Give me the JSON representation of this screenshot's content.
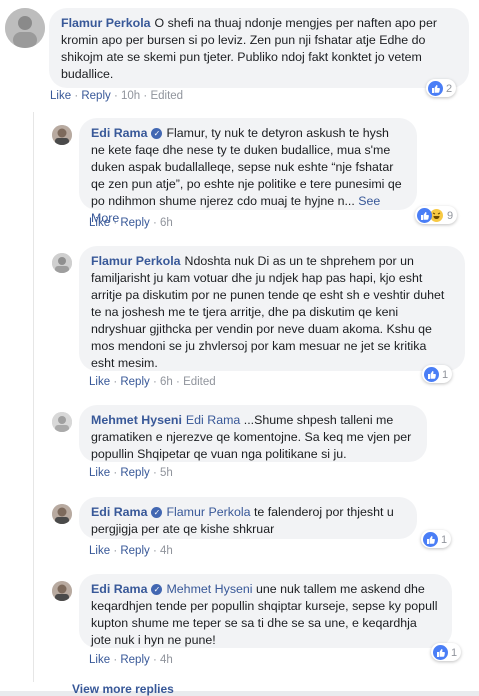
{
  "comments": [
    {
      "name": "Flamur Perkola",
      "verified": false,
      "mention": "",
      "text": "O shefi na thuaj ndonje mengjes per naften apo per kromin apo per bursen si po leviz. Zen pun nji fshatar atje Edhe do shikojm ate se skemi pun tjeter. Publiko ndoj fakt konktet jo vetem budallice.",
      "see_more": "",
      "like": "Like",
      "reply": "Reply",
      "time": "10h",
      "edited": "Edited",
      "reaction_count": "2"
    },
    {
      "name": "Edi Rama",
      "verified": true,
      "mention": "",
      "text": "Flamur, ty nuk te detyron askush te hysh ne kete faqe dhe nese ty te duken budallice, mua s'me duken aspak budallalleqe, sepse nuk eshte “nje fshatar qe zen pun atje”, po eshte nje politike e tere punesimi qe po ndihmon shume njerez cdo muaj te hyjne n...",
      "see_more": "See More",
      "like": "Like",
      "reply": "Reply",
      "time": "6h",
      "edited": "",
      "reaction_count": "9"
    },
    {
      "name": "Flamur Perkola",
      "verified": false,
      "mention": "",
      "text": "Ndoshta nuk Di as un te shprehem por un familjarisht ju kam votuar dhe ju ndjek hap pas hapi, kjo esht arritje pa diskutim por ne punen tende qe esht sh e veshtir duhet te na joshesh me te tjera arritje, dhe pa diskutim qe keni ndryshuar gjithcka per vendin por neve duam akoma. Kshu qe mos mendoni se ju zhvlersoj por kam mesuar ne jet se kritika esht mesim.",
      "see_more": "",
      "like": "Like",
      "reply": "Reply",
      "time": "6h",
      "edited": "Edited",
      "reaction_count": "1"
    },
    {
      "name": "Mehmet Hyseni",
      "verified": false,
      "mention": "Edi Rama",
      "text": "...Shume shpesh talleni me gramatiken e njerezve qe komentojne. Sa keq me vjen per popullin Shqipetar qe vuan nga politikane si ju.",
      "see_more": "",
      "like": "Like",
      "reply": "Reply",
      "time": "5h",
      "edited": "",
      "reaction_count": ""
    },
    {
      "name": "Edi Rama",
      "verified": true,
      "mention": "Flamur Perkola",
      "text": "te falenderoj por thjesht u pergjigja per ate qe kishe shkruar",
      "see_more": "",
      "like": "Like",
      "reply": "Reply",
      "time": "4h",
      "edited": "",
      "reaction_count": "1"
    },
    {
      "name": "Edi Rama",
      "verified": true,
      "mention": "Mehmet Hyseni",
      "text": "une nuk tallem me askend dhe keqardhjen tende per popullin shqiptar kurseje, sepse ky popull kupton shume me teper se sa ti dhe se sa une, e keqardhja jote nuk i hyn ne pune!",
      "see_more": "",
      "like": "Like",
      "reply": "Reply",
      "time": "4h",
      "edited": "",
      "reaction_count": "1"
    }
  ],
  "view_more": "View more replies",
  "colors": {
    "link": "#385898",
    "muted": "#90949c",
    "bubble": "#f2f3f5",
    "like_blue": "#4a7ef6",
    "haha_yellow": "#f7c944"
  }
}
